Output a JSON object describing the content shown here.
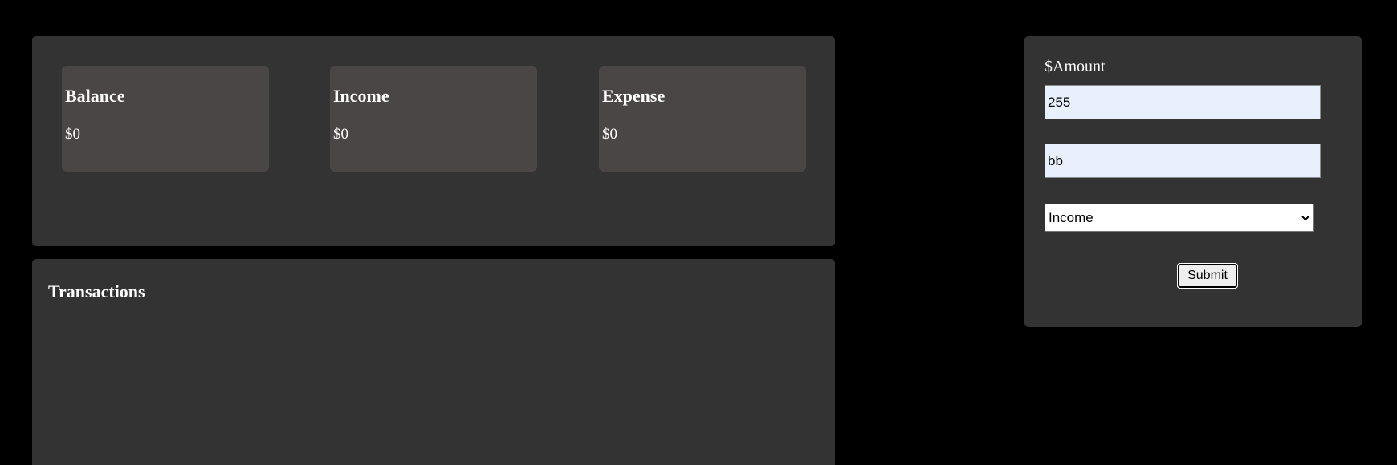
{
  "summary": {
    "balance": {
      "title": "Balance",
      "value": "$0"
    },
    "income": {
      "title": "Income",
      "value": "$0"
    },
    "expense": {
      "title": "Expense",
      "value": "$0"
    }
  },
  "transactions": {
    "title": "Transactions",
    "items": []
  },
  "form": {
    "amount_label": "$Amount",
    "amount_value": "255",
    "description_value": "bb",
    "type_selected": "Income",
    "submit_label": "Submit"
  },
  "colors": {
    "background": "#000000",
    "panel": "#333333",
    "card": "#4a4645",
    "input": "#e8f0fe"
  },
  "icons": {
    "select_arrow": "chevron-down-icon"
  }
}
